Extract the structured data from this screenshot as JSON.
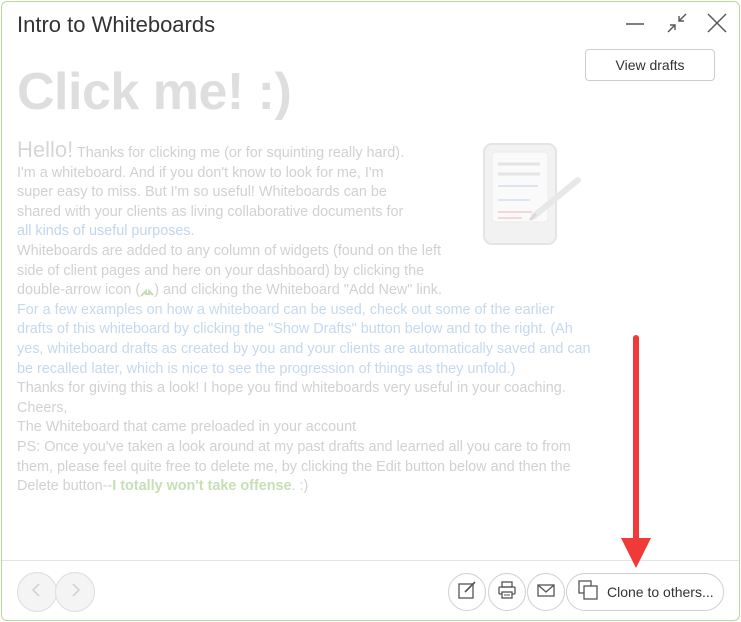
{
  "window": {
    "title": "Intro to Whiteboards"
  },
  "toolbar": {
    "view_drafts_label": "View drafts"
  },
  "whiteboard": {
    "heading": "Click me! :)",
    "greeting": "Hello!",
    "intro_line": " Thanks for clicking me (or for squinting really hard).",
    "p1": "I'm a whiteboard.  And if you don't know to look for me, I'm super easy to miss.  But I'm so useful!  Whiteboards can be shared with your clients as living collaborative documents for ",
    "p1_link": "all kinds of useful purposes",
    "p1_end": ".",
    "p2_a": "Whiteboards are added to any column of widgets (found on the left side of client pages and here on your dashboard) by clicking the double-arrow icon (",
    "p2_b": ") and clicking the Whiteboard \"Add New\" link.",
    "p3": "For a few examples on how a whiteboard can be used, check out some of the earlier drafts of this whiteboard by clicking the \"Show Drafts\" button below and to the right. (Ah yes, whiteboard drafts as created by you and your clients are automatically saved and can be recalled later, which is nice to see the progression of things as they unfold.)",
    "p4": "Thanks for giving this a look!  I hope you find whiteboards very useful in your coaching.",
    "p5": "Cheers,",
    "p6": "The Whiteboard that came preloaded in your account",
    "p7_a": "PS: Once you've taken a look around at my past drafts and learned all you care to from them, please feel quite free to delete me, by clicking the Edit button below and then the Delete button--",
    "p7_strong": "I totally won't take offense",
    "p7_end": ". :)"
  },
  "footer": {
    "clone_label": "Clone to others..."
  },
  "icons": {
    "minimize": "minimize-icon",
    "restore": "restore-icon",
    "close": "close-icon",
    "prev": "chevron-left-icon",
    "next": "chevron-right-icon",
    "edit": "edit-icon",
    "print": "print-icon",
    "email": "email-icon",
    "clone": "clone-icon"
  },
  "colors": {
    "window_border": "#b9d99a",
    "arrow": "#f03a3a",
    "link_blue": "#c2d6ec",
    "strong_green": "#c6dfb6"
  }
}
